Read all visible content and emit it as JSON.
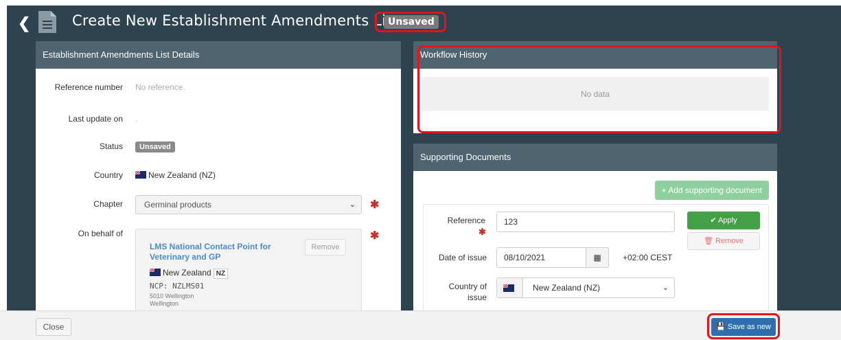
{
  "header": {
    "title": "Create New Establishment Amendments List",
    "status_badge": "Unsaved"
  },
  "details_panel": {
    "title": "Establishment Amendments List Details",
    "reference_label": "Reference number",
    "reference_value": "No reference.",
    "last_update_label": "Last update on",
    "last_update_value": ".",
    "status_label": "Status",
    "status_value": "Unsaved",
    "country_label": "Country",
    "country_value": "New Zealand (NZ)",
    "chapter_label": "Chapter",
    "chapter_value": "Germinal products",
    "behalf_label": "On behalf of",
    "behalf": {
      "name": "LMS National Contact Point for Veterinary and GP",
      "remove_label": "Remove",
      "country": "New Zealand",
      "country_code": "NZ",
      "ncp": "NCP: NZLMS01",
      "address_line1": "5010 Wellington",
      "address_line2": "Wellington"
    }
  },
  "workflow_panel": {
    "title": "Workflow History",
    "empty_text": "No data"
  },
  "supporting_docs": {
    "title": "Supporting Documents",
    "add_button": "+ Add supporting document",
    "reference_label": "Reference",
    "reference_value": "123",
    "apply_label": "✔ Apply",
    "remove_label": "🗑 Remove",
    "date_label": "Date of issue",
    "date_value": "08/10/2021",
    "timezone": "+02:00 CEST",
    "country_label_1": "Country of",
    "country_label_2": "issue",
    "country_value": "New Zealand (NZ)"
  },
  "footer": {
    "close_label": "Close",
    "save_label": "💾 Save as new"
  },
  "colors": {
    "app_bg": "#2d4350",
    "panel_header": "#4e6470",
    "highlight": "#e3141b",
    "save_button": "#2f6fb0",
    "apply_button": "#43a047"
  }
}
